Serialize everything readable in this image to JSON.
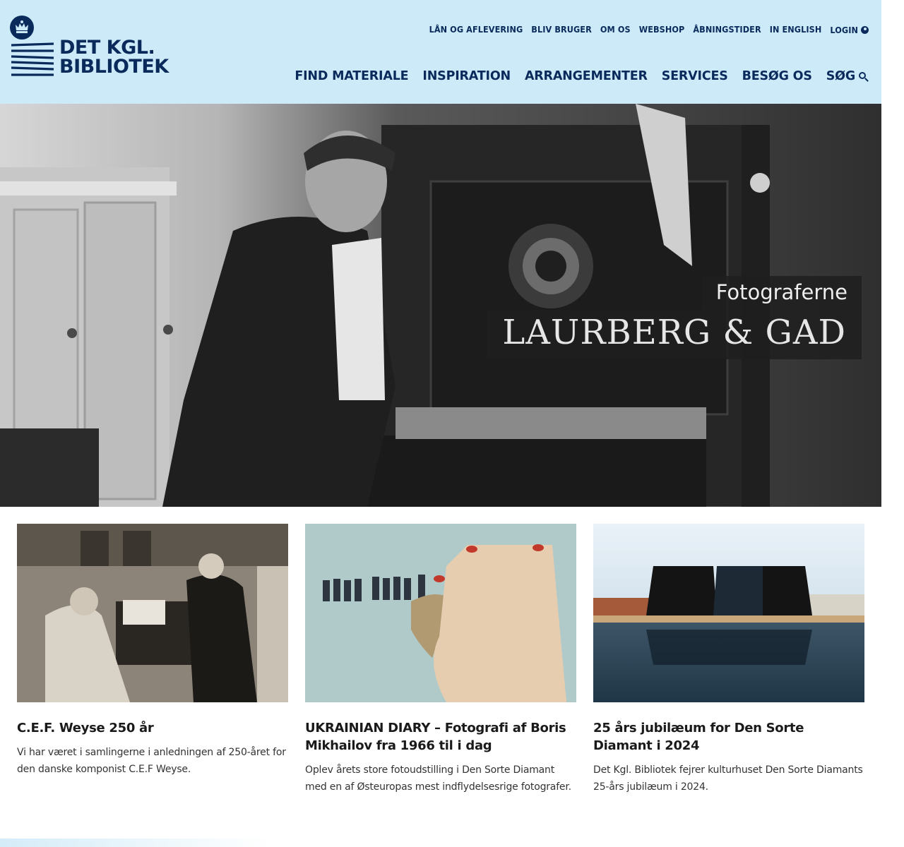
{
  "brand": {
    "line1": "DET KGL.",
    "line2": "BIBLIOTEK",
    "color": "#0a2a5c",
    "header_bg": "#cdeaf8"
  },
  "topnav": [
    "LÅN OG AFLEVERING",
    "BLIV BRUGER",
    "OM OS",
    "WEBSHOP",
    "ÅBNINGSTIDER",
    "IN ENGLISH",
    "LOGIN"
  ],
  "mainnav": [
    "FIND MATERIALE",
    "INSPIRATION",
    "ARRANGEMENTER",
    "SERVICES",
    "BESØG OS",
    "SØG"
  ],
  "hero": {
    "subtitle": "Fotograferne",
    "title": "LAURBERG & GAD"
  },
  "cards": [
    {
      "title": "C.E.F. Weyse 250 år",
      "text": "Vi har været i samlingerne i anledningen af 250-året for den danske komponist C.E.F Weyse."
    },
    {
      "title": "UKRAINIAN DIARY – Fotografi af Boris Mikhailov fra 1966 til i dag",
      "text": "Oplev årets store fotoudstilling i Den Sorte Diamant med en af Østeuropas mest indflydelsesrige fotografer."
    },
    {
      "title": "25 års jubilæum for Den Sorte Diamant i 2024",
      "text": "Det Kgl. Bibliotek fejrer kulturhuset Den Sorte Diamants 25-års jubilæum i 2024."
    }
  ]
}
